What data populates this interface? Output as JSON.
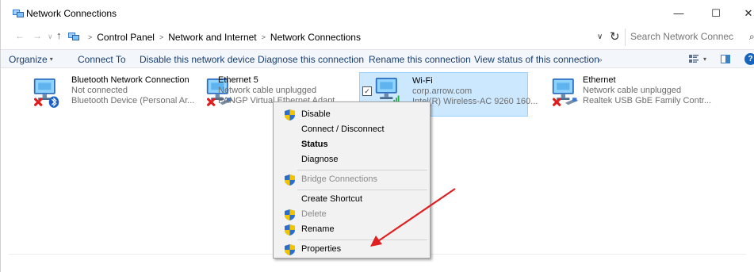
{
  "window": {
    "title": "Network Connections",
    "minimize": "—",
    "maximize": "☐",
    "close": "✕"
  },
  "address": {
    "crumbs": [
      "Control Panel",
      "Network and Internet",
      "Network Connections"
    ],
    "search_placeholder": "Search Network Connections"
  },
  "toolbar": {
    "organize": "Organize",
    "connect_to": "Connect To",
    "disable": "Disable this network device",
    "diagnose": "Diagnose this connection",
    "rename": "Rename this connection",
    "view_status": "View status of this connection"
  },
  "connections": [
    {
      "name": "Bluetooth Network Connection",
      "status": "Not connected",
      "device": "Bluetooth Device (Personal Ar...",
      "icon": "bluetooth-adapter-icon"
    },
    {
      "name": "Ethernet 5",
      "status": "Network cable unplugged",
      "device": "PANGP Virtual Ethernet Adapt...",
      "icon": "ethernet-adapter-icon"
    },
    {
      "name": "Wi-Fi",
      "status": "corp.arrow.com",
      "device": "Intel(R) Wireless-AC 9260 160...",
      "icon": "wifi-adapter-icon",
      "selected": true
    },
    {
      "name": "Ethernet",
      "status": "Network cable unplugged",
      "device": "Realtek USB GbE Family Contr...",
      "icon": "ethernet-adapter-icon"
    }
  ],
  "context_menu": {
    "disable": "Disable",
    "connect_disconnect": "Connect / Disconnect",
    "status": "Status",
    "diagnose": "Diagnose",
    "bridge": "Bridge Connections",
    "create_shortcut": "Create Shortcut",
    "delete": "Delete",
    "rename": "Rename",
    "properties": "Properties"
  },
  "colors": {
    "selection_bg": "#cce8ff",
    "selection_border": "#99d1ff",
    "link_text": "#1a3f6e",
    "annotation_arrow": "#e02020"
  }
}
